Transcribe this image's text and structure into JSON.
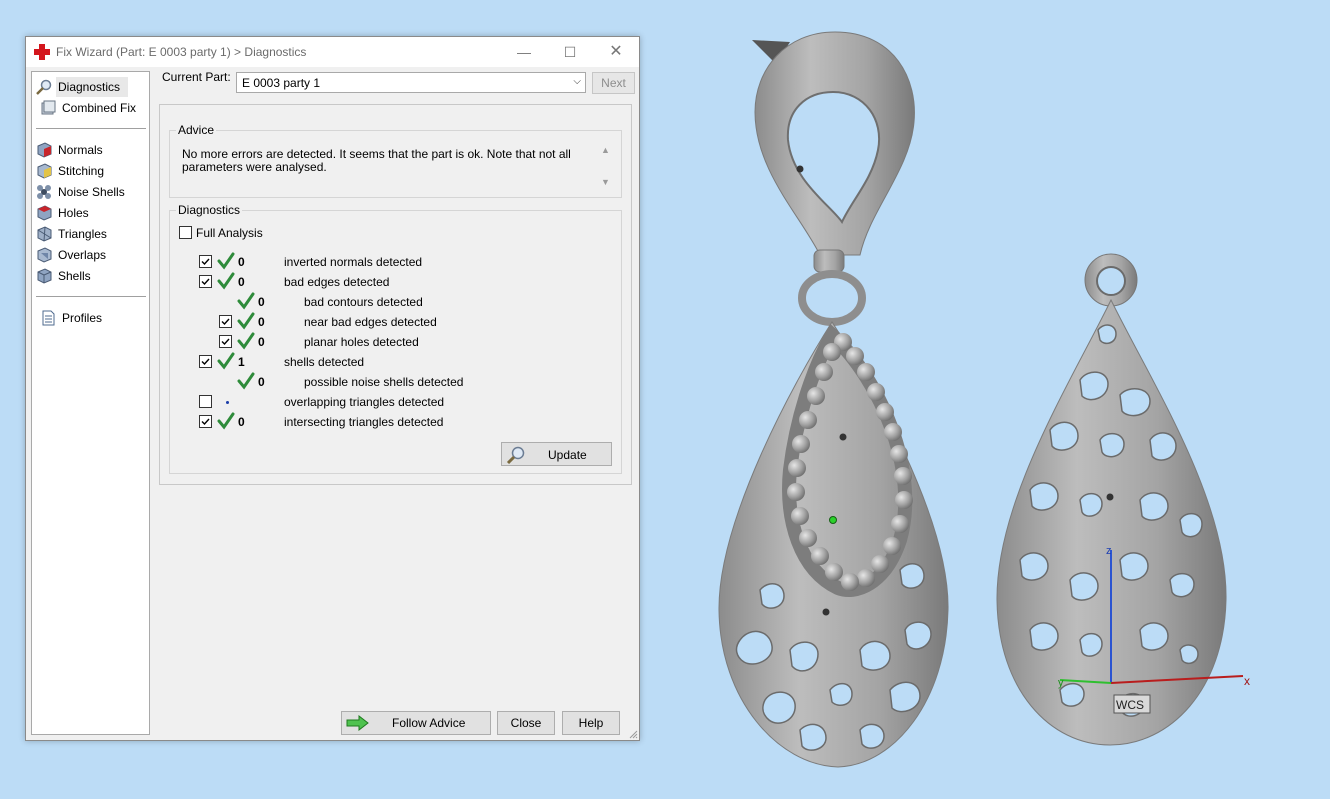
{
  "window": {
    "title": "Fix Wizard (Part: E 0003 party 1) > Diagnostics",
    "minimize": "—",
    "maximize": "☐",
    "close": "✕"
  },
  "nav": {
    "items": [
      {
        "label": "Diagnostics",
        "icon": "magnifier-icon",
        "selected": true
      },
      {
        "label": "Combined Fix",
        "icon": "combined-fix-icon"
      },
      {
        "label": "Normals",
        "icon": "normals-icon"
      },
      {
        "label": "Stitching",
        "icon": "stitching-icon"
      },
      {
        "label": "Noise Shells",
        "icon": "noise-shells-icon"
      },
      {
        "label": "Holes",
        "icon": "holes-icon"
      },
      {
        "label": "Triangles",
        "icon": "triangles-icon"
      },
      {
        "label": "Overlaps",
        "icon": "overlaps-icon"
      },
      {
        "label": "Shells",
        "icon": "shells-icon"
      },
      {
        "label": "Profiles",
        "icon": "document-icon"
      }
    ]
  },
  "part": {
    "label": "Current Part:",
    "value": "E 0003 party 1",
    "next": "Next"
  },
  "advice": {
    "title": "Advice",
    "text": "No more errors are detected. It seems that the part is ok. Note that not all parameters were analysed."
  },
  "diagnostics": {
    "title": "Diagnostics",
    "full_analysis": "Full Analysis",
    "rows": [
      {
        "label": "inverted normals detected",
        "count": "0",
        "checked": true,
        "status": "ok",
        "indent": 0
      },
      {
        "label": "bad edges detected",
        "count": "0",
        "checked": true,
        "status": "ok",
        "indent": 0
      },
      {
        "label": "bad contours detected",
        "count": "0",
        "checked": null,
        "status": "ok",
        "indent": 1
      },
      {
        "label": "near bad edges detected",
        "count": "0",
        "checked": true,
        "status": "ok",
        "indent": 1
      },
      {
        "label": "planar holes detected",
        "count": "0",
        "checked": true,
        "status": "ok",
        "indent": 1
      },
      {
        "label": "shells detected",
        "count": "1",
        "checked": true,
        "status": "ok",
        "indent": 0
      },
      {
        "label": "possible noise shells detected",
        "count": "0",
        "checked": null,
        "status": "ok",
        "indent": 1
      },
      {
        "label": "overlapping triangles detected",
        "count": "",
        "checked": false,
        "status": "none",
        "indent": 0
      },
      {
        "label": "intersecting triangles detected",
        "count": "0",
        "checked": true,
        "status": "ok",
        "indent": 0
      }
    ],
    "update": "Update"
  },
  "buttons": {
    "follow_advice": "Follow Advice",
    "close": "Close",
    "help": "Help"
  },
  "viewport": {
    "axis_x": "x",
    "axis_z": "z",
    "axis_y": "y",
    "wcs": "WCS"
  },
  "colors": {
    "background": "#bcdcf6",
    "check_green": "#2e8b3a",
    "model_gray": "#a9a9a9"
  }
}
